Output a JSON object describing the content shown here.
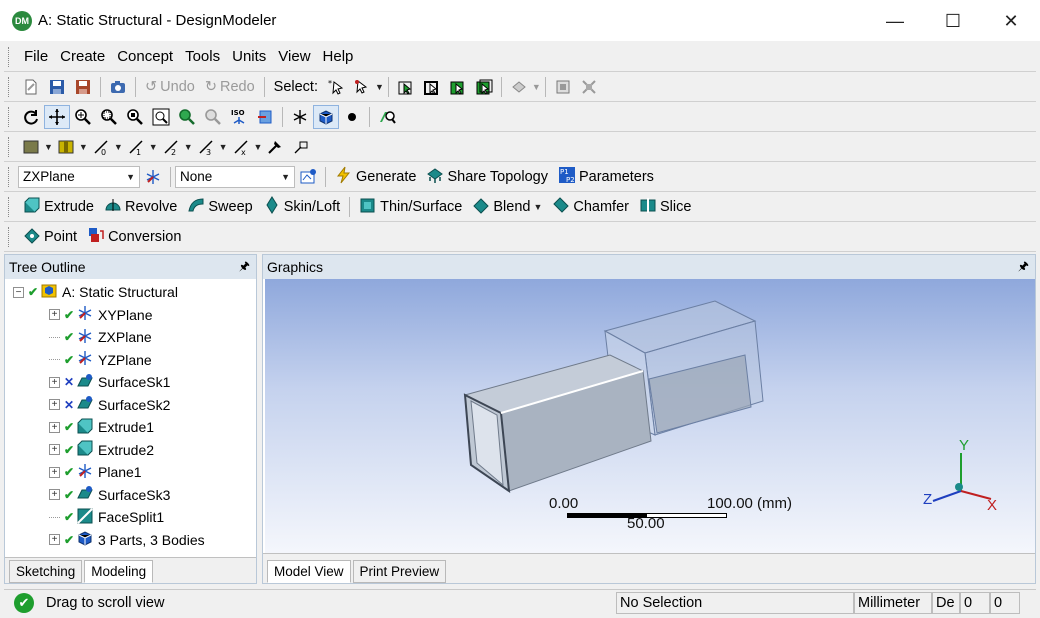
{
  "window": {
    "icon_text": "DM",
    "title": "A: Static Structural - DesignModeler",
    "minimize": "—",
    "maximize": "☐",
    "close": "✕"
  },
  "menu": [
    "File",
    "Create",
    "Concept",
    "Tools",
    "Units",
    "View",
    "Help"
  ],
  "toolbar1": {
    "undo_label": "Undo",
    "redo_label": "Redo",
    "select_label": "Select:"
  },
  "toolbar4": {
    "plane_select": "ZXPlane",
    "sketch_select": "None",
    "generate_label": "Generate",
    "share_topology_label": "Share Topology",
    "parameters_label": "Parameters"
  },
  "toolbar5": {
    "extrude_label": "Extrude",
    "revolve_label": "Revolve",
    "sweep_label": "Sweep",
    "skin_label": "Skin/Loft",
    "thin_label": "Thin/Surface",
    "blend_label": "Blend",
    "chamfer_label": "Chamfer",
    "slice_label": "Slice"
  },
  "toolbar6": {
    "point_label": "Point",
    "conversion_label": "Conversion"
  },
  "tree_panel": {
    "title": "Tree Outline",
    "pin": "🖈",
    "root": "A: Static Structural",
    "items": [
      {
        "label": "XYPlane",
        "expander": true,
        "mark": "✔"
      },
      {
        "label": "ZXPlane",
        "expander": false,
        "mark": "✔"
      },
      {
        "label": "YZPlane",
        "expander": false,
        "mark": "✔"
      },
      {
        "label": "SurfaceSk1",
        "expander": true,
        "mark": "✕"
      },
      {
        "label": "SurfaceSk2",
        "expander": true,
        "mark": "✕"
      },
      {
        "label": "Extrude1",
        "expander": true,
        "mark": "✔"
      },
      {
        "label": "Extrude2",
        "expander": true,
        "mark": "✔"
      },
      {
        "label": "Plane1",
        "expander": true,
        "mark": "✔"
      },
      {
        "label": "SurfaceSk3",
        "expander": true,
        "mark": "✔"
      },
      {
        "label": "FaceSplit1",
        "expander": false,
        "mark": "✔"
      },
      {
        "label": "3 Parts, 3 Bodies",
        "expander": true,
        "mark": "✔"
      }
    ],
    "tab_sketching": "Sketching",
    "tab_modeling": "Modeling"
  },
  "graphics_panel": {
    "title": "Graphics",
    "pin": "🖈",
    "scale_start": "0.00",
    "scale_end": "100.00 (mm)",
    "scale_mid": "50.00",
    "axis_y": "Y",
    "axis_z": "Z",
    "axis_x": "X",
    "tab_model_view": "Model View",
    "tab_print_preview": "Print Preview"
  },
  "statusbar": {
    "message": "Drag to scroll view",
    "selection": "No Selection",
    "units": "Millimeter",
    "angle_units": "De",
    "value1": "0",
    "value2": "0"
  }
}
